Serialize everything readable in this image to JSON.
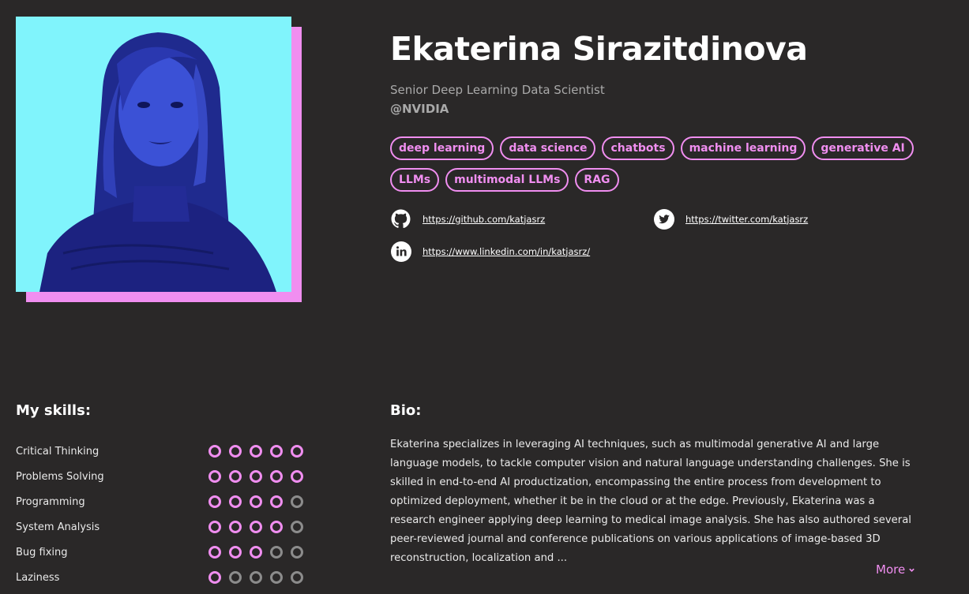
{
  "profile": {
    "name": "Ekaterina Sirazitdinova",
    "title": "Senior Deep Learning Data Scientist",
    "company": "@NVIDIA"
  },
  "tags": [
    "deep learning",
    "data science",
    "chatbots",
    "machine learning",
    "generative AI",
    "LLMs",
    "multimodal LLMs",
    "RAG"
  ],
  "links": {
    "github": "https://github.com/katjasrz",
    "twitter": "https://twitter.com/katjasrz",
    "linkedin": "https://www.linkedin.com/in/katjasrz/"
  },
  "skills_title": "My skills:",
  "skills": [
    {
      "name": "Critical Thinking",
      "level": 5
    },
    {
      "name": "Problems Solving",
      "level": 5
    },
    {
      "name": "Programming",
      "level": 4
    },
    {
      "name": "System Analysis",
      "level": 4
    },
    {
      "name": "Bug fixing",
      "level": 3
    },
    {
      "name": "Laziness",
      "level": 1
    }
  ],
  "skills_max": 5,
  "bio_title": "Bio:",
  "bio_text": "Ekaterina specializes in leveraging AI techniques, such as multimodal generative AI and large language models, to tackle computer vision and natural language understanding challenges. She is skilled in end-to-end AI productization, encompassing the entire process from development to optimized deployment, whether it be in the cloud or at the edge. Previously, Ekaterina was a research engineer applying deep learning to medical image analysis. She has also authored several peer-reviewed journal and conference publications on various applications of image-based 3D reconstruction, localization and ...",
  "more_label": "More",
  "colors": {
    "accent": "#f08ef0",
    "background": "#2a2828",
    "photo_bg": "#80f4fc",
    "inactive": "#8c8c8c"
  }
}
